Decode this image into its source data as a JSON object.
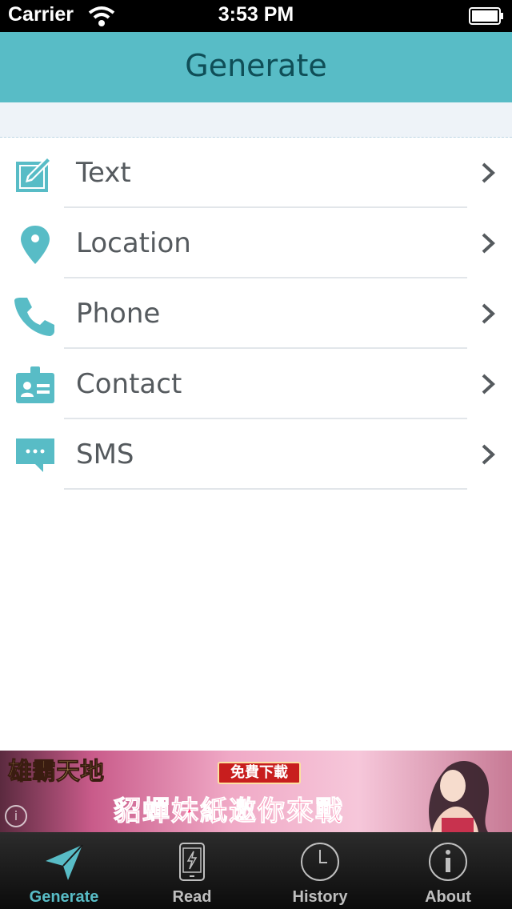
{
  "status_bar": {
    "carrier": "Carrier",
    "time": "3:53 PM"
  },
  "nav_bar": {
    "title": "Generate"
  },
  "menu": [
    {
      "label": "Text",
      "icon": "edit-icon"
    },
    {
      "label": "Location",
      "icon": "location-pin-icon"
    },
    {
      "label": "Phone",
      "icon": "phone-icon"
    },
    {
      "label": "Contact",
      "icon": "contact-card-icon"
    },
    {
      "label": "SMS",
      "icon": "sms-bubble-icon"
    }
  ],
  "ad": {
    "logo_text": "雄霸天地",
    "cta": "免費下載",
    "headline": "貂蟬妹紙邀你來戰",
    "info": "i"
  },
  "tabs": [
    {
      "label": "Generate",
      "icon": "paper-plane-icon",
      "active": true
    },
    {
      "label": "Read",
      "icon": "phone-scan-icon",
      "active": false
    },
    {
      "label": "History",
      "icon": "clock-icon",
      "active": false
    },
    {
      "label": "About",
      "icon": "info-icon",
      "active": false
    }
  ],
  "colors": {
    "accent": "#58bcc6",
    "nav_title": "#0f4e57",
    "label": "#555a5e"
  }
}
